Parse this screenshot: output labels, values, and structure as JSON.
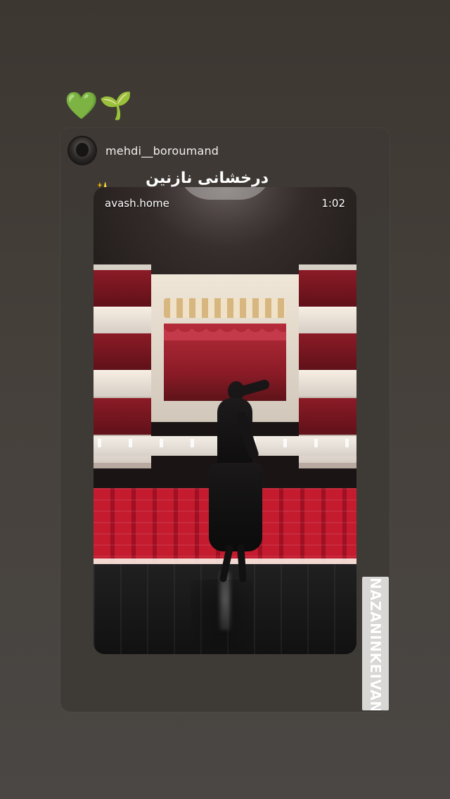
{
  "stickers": {
    "heart": "💚",
    "sprout": "🌱"
  },
  "card": {
    "author": "mehdi__boroumand",
    "caption": "درخشانی نازنین جان",
    "caption_emoji": "✨"
  },
  "video": {
    "source": "avash.home",
    "duration": "1:02"
  },
  "side_tag": {
    "text": "@NAZANINKEIVANII"
  },
  "colors": {
    "background": "#423c37",
    "card": "#3e3935",
    "heart": "#7ed957",
    "sparkle": "#f7d145",
    "tag": "#d8d7d6"
  }
}
